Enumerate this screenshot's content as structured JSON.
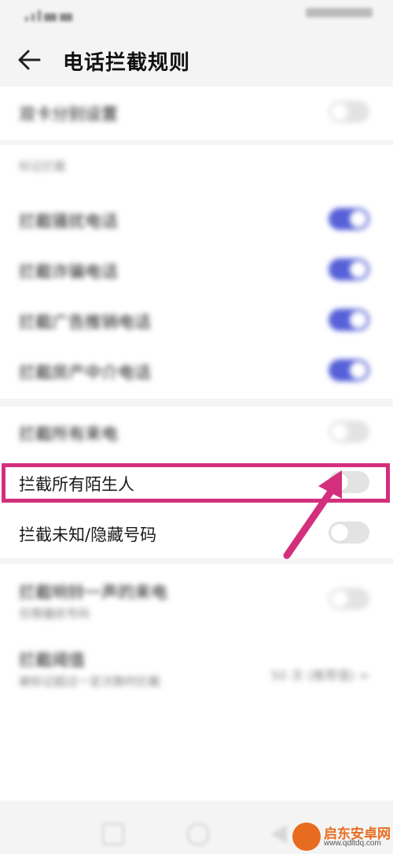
{
  "header": {
    "title": "电话拦截规则"
  },
  "section1": {
    "dual_sim": {
      "label": "双卡分别设置",
      "on": false
    }
  },
  "section2": {
    "header": "标记拦截",
    "items": [
      {
        "label": "拦截骚扰电话",
        "on": true
      },
      {
        "label": "拦截诈骗电话",
        "on": true
      },
      {
        "label": "拦截广告推销电话",
        "on": true
      },
      {
        "label": "拦截房产中介电话",
        "on": true
      }
    ]
  },
  "section3": {
    "items": [
      {
        "label": "拦截所有来电",
        "on": false
      },
      {
        "label": "拦截所有陌生人",
        "on": false
      },
      {
        "label": "拦截未知/隐藏号码",
        "on": false
      }
    ]
  },
  "section4": {
    "ring_once": {
      "label": "拦截响铃一声的来电",
      "sublabel": "仅限骚扰号码",
      "on": false
    },
    "blocklist": {
      "label": "拦截阈值",
      "sublabel": "被标记超过一定次数时拦截",
      "value": "50 次 (推荐值) >"
    }
  },
  "watermark": {
    "brand": "启东安卓网",
    "url": "www.qdltdq.com"
  },
  "colors": {
    "accent": "#5660d8",
    "highlight": "#d32f7d",
    "brand": "#e86c1f"
  }
}
